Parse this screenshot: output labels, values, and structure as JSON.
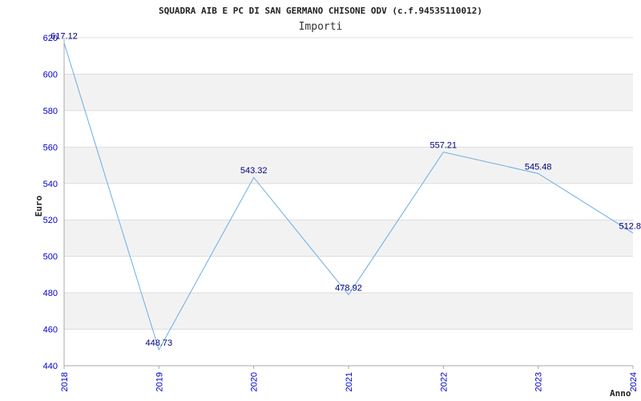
{
  "chart_data": {
    "type": "line",
    "title": "SQUADRA AIB E PC DI SAN GERMANO CHISONE ODV (c.f.94535110012)",
    "subtitle": "Importi",
    "xlabel": "Anno",
    "ylabel": "Euro",
    "x": [
      "2018",
      "2019",
      "2020",
      "2021",
      "2022",
      "2023",
      "2024"
    ],
    "values": [
      617.12,
      448.73,
      543.32,
      478.92,
      557.21,
      545.48,
      512.8
    ],
    "data_labels": [
      "617.12",
      "448.73",
      "543.32",
      "478.92",
      "557.21",
      "545.48",
      "512.8"
    ],
    "ylim": [
      440,
      620
    ],
    "yticks": [
      440,
      460,
      480,
      500,
      520,
      540,
      560,
      580,
      600,
      620
    ],
    "grid": true,
    "banded_background": true,
    "colors": {
      "line": "#6aaee8",
      "tick_text": "#0000cc",
      "data_label": "#000080",
      "band": "#f2f2f2",
      "grid": "#dddddd",
      "axis": "#aaaaaa"
    }
  }
}
